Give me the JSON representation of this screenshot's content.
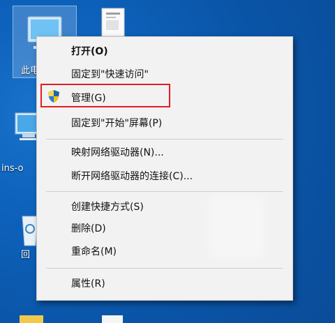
{
  "desktop": {
    "icons": [
      {
        "label": "此电"
      },
      {
        "label": ""
      },
      {
        "label": "ins-o"
      },
      {
        "label": "回"
      }
    ]
  },
  "menu": {
    "items": [
      {
        "label": "打开(O)"
      },
      {
        "label": "固定到\"快速访问\""
      },
      {
        "label": "管理(G)"
      },
      {
        "label": "固定到\"开始\"屏幕(P)"
      },
      {
        "label": "映射网络驱动器(N)..."
      },
      {
        "label": "断开网络驱动器的连接(C)..."
      },
      {
        "label": "创建快捷方式(S)"
      },
      {
        "label": "删除(D)"
      },
      {
        "label": "重命名(M)"
      },
      {
        "label": "属性(R)"
      }
    ]
  },
  "colors": {
    "desktop_bg": "#0a55a8",
    "menu_bg": "#f2f2f2",
    "highlight": "#e51c23"
  }
}
